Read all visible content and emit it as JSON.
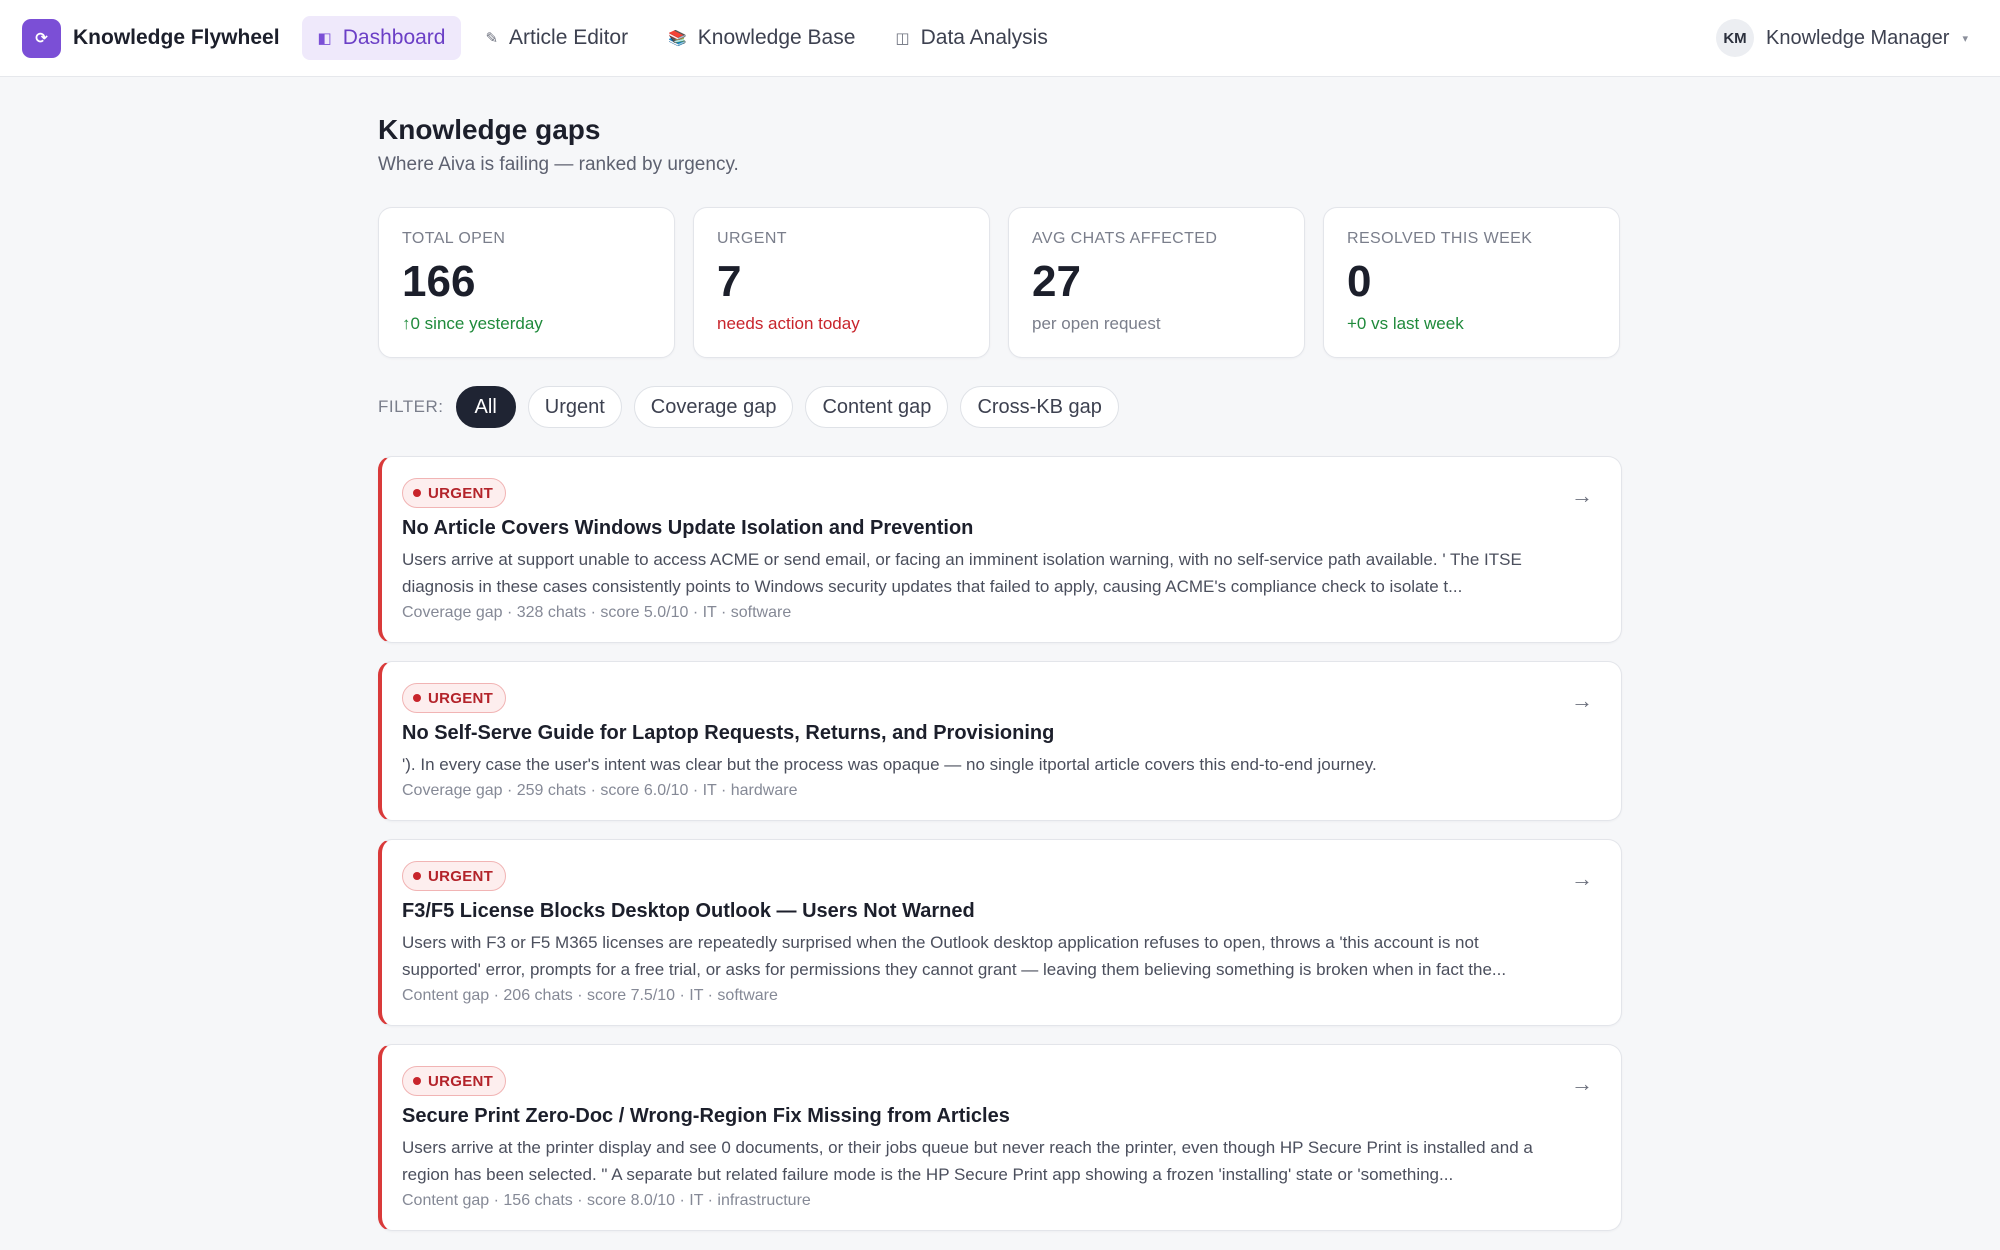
{
  "app": {
    "name": "Knowledge Flywheel",
    "logo_glyph": "⟳"
  },
  "nav": {
    "items": [
      {
        "label": "Dashboard",
        "icon": "◧",
        "active": true
      },
      {
        "label": "Article Editor",
        "icon": "✎",
        "active": false
      },
      {
        "label": "Knowledge Base",
        "icon": "📚",
        "active": false
      },
      {
        "label": "Data Analysis",
        "icon": "◫",
        "active": false
      }
    ]
  },
  "user": {
    "initials": "KM",
    "name": "Knowledge Manager",
    "caret": "▾"
  },
  "page": {
    "title": "Knowledge gaps",
    "subtitle": "Where Aiva is failing — ranked by urgency."
  },
  "stats": [
    {
      "label": "TOTAL OPEN",
      "value": "166",
      "note": "↑0 since yesterday",
      "tone": "green"
    },
    {
      "label": "URGENT",
      "value": "7",
      "note": "needs action today",
      "tone": "red"
    },
    {
      "label": "AVG CHATS AFFECTED",
      "value": "27",
      "note": "per open request",
      "tone": "grey"
    },
    {
      "label": "RESOLVED THIS WEEK",
      "value": "0",
      "note": "+0 vs last week",
      "tone": "green"
    }
  ],
  "filters": {
    "label": "FILTER:",
    "options": [
      {
        "label": "All",
        "active": true
      },
      {
        "label": "Urgent",
        "active": false
      },
      {
        "label": "Coverage gap",
        "active": false
      },
      {
        "label": "Content gap",
        "active": false
      },
      {
        "label": "Cross-KB gap",
        "active": false
      }
    ]
  },
  "gaps": [
    {
      "badge": "URGENT",
      "title": "No Article Covers Windows Update Isolation and Prevention",
      "description": "Users arrive at support unable to access ACME or send email, or facing an imminent isolation warning, with no self-service path available. ' The ITSE diagnosis in these cases consistently points to Windows security updates that failed to apply, causing ACME's compliance check to isolate t...",
      "meta": "Coverage gap · 328 chats · score 5.0/10 · IT · software",
      "arrow": "→"
    },
    {
      "badge": "URGENT",
      "title": "No Self-Serve Guide for Laptop Requests, Returns, and Provisioning",
      "description": "'). In every case the user's intent was clear but the process was opaque — no single itportal article covers this end-to-end journey.",
      "meta": "Coverage gap · 259 chats · score 6.0/10 · IT · hardware",
      "arrow": "→"
    },
    {
      "badge": "URGENT",
      "title": "F3/F5 License Blocks Desktop Outlook — Users Not Warned",
      "description": "Users with F3 or F5 M365 licenses are repeatedly surprised when the Outlook desktop application refuses to open, throws a 'this account is not supported' error, prompts for a free trial, or asks for permissions they cannot grant — leaving them believing something is broken when in fact the...",
      "meta": "Content gap · 206 chats · score 7.5/10 · IT · software",
      "arrow": "→"
    },
    {
      "badge": "URGENT",
      "title": "Secure Print Zero-Doc / Wrong-Region Fix Missing from Articles",
      "description": "Users arrive at the printer display and see 0 documents, or their jobs queue but never reach the printer, even though HP Secure Print is installed and a region has been selected. \" A separate but related failure mode is the HP Secure Print app showing a frozen 'installing' state or 'something...",
      "meta": "Content gap · 156 chats · score 8.0/10 · IT · infrastructure",
      "arrow": "→"
    }
  ]
}
